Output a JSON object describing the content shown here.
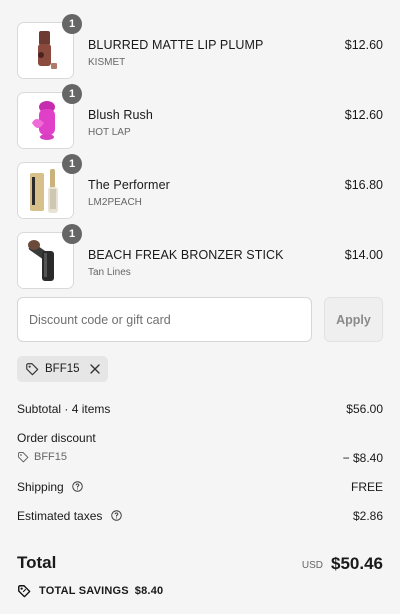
{
  "items": [
    {
      "quantity": "1",
      "name": "BLURRED MATTE LIP PLUMP",
      "variant": "KISMET",
      "price": "$12.60",
      "image_icon": "lip-plump-product-icon",
      "colors": {
        "main": "#8b4a3e",
        "cap": "#6e3b32"
      }
    },
    {
      "quantity": "1",
      "name": "Blush Rush",
      "variant": "HOT LAP",
      "price": "$12.60",
      "image_icon": "blush-product-icon",
      "colors": {
        "main": "#e040c8",
        "cap": "#c52cb0"
      }
    },
    {
      "quantity": "1",
      "name": "The Performer",
      "variant": "LM2PEACH",
      "price": "$16.80",
      "image_icon": "concealer-product-icon",
      "colors": {
        "main": "#d8c08a",
        "cap": "#c9b37a"
      }
    },
    {
      "quantity": "1",
      "name": "BEACH FREAK BRONZER STICK",
      "variant": "Tan Lines",
      "price": "$14.00",
      "image_icon": "bronzer-stick-product-icon",
      "colors": {
        "main": "#2a2a2a",
        "cap": "#6b4a3a"
      }
    }
  ],
  "discount": {
    "placeholder": "Discount code or gift card",
    "value": "",
    "apply_label": "Apply"
  },
  "applied_code": {
    "code": "BFF15"
  },
  "summary": {
    "subtotal_label": "Subtotal · 4 items",
    "subtotal_value": "$56.00",
    "order_discount_label": "Order discount",
    "order_discount_code": "BFF15",
    "order_discount_value": "− $8.40",
    "shipping_label": "Shipping",
    "shipping_value": "FREE",
    "taxes_label": "Estimated taxes",
    "taxes_value": "$2.86"
  },
  "total": {
    "label": "Total",
    "currency": "USD",
    "value": "$50.46"
  },
  "savings": {
    "label": "TOTAL SAVINGS",
    "value": "$8.40"
  }
}
